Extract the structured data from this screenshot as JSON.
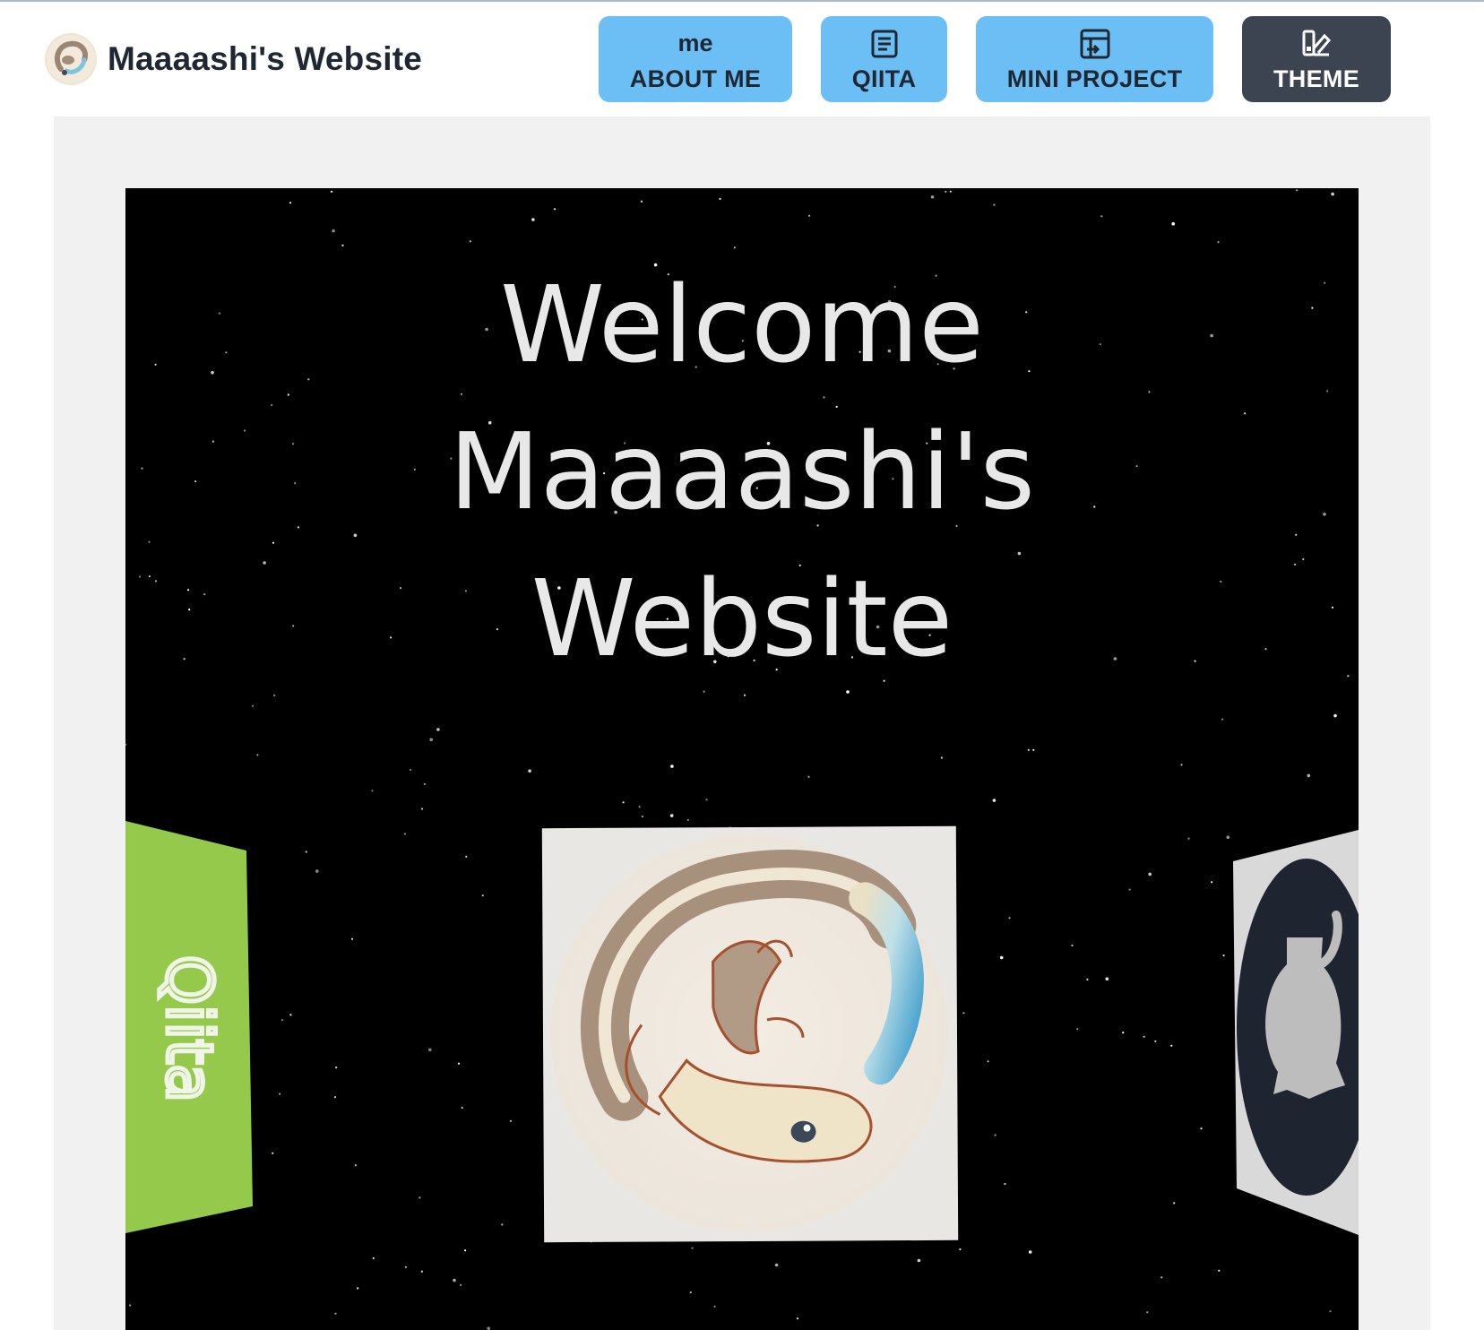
{
  "header": {
    "title": "Maaaashi's Website",
    "logo_icon": "salamander-logo-icon"
  },
  "nav": [
    {
      "id": "about",
      "top_text": "me",
      "label": "ABOUT ME",
      "icon": "me-text-icon"
    },
    {
      "id": "qiita",
      "top_text": "",
      "label": "QIITA",
      "icon": "article-icon"
    },
    {
      "id": "mini",
      "top_text": "",
      "label": "MINI PROJECT",
      "icon": "project-icon"
    },
    {
      "id": "theme",
      "top_text": "",
      "label": "THEME",
      "icon": "palette-icon"
    }
  ],
  "hero": {
    "line1": "Welcome",
    "line2": "Maaaashi's",
    "line3": "Website"
  },
  "carousel": {
    "left_panel_label": "Qiita",
    "center_icon": "salamander-illustration-icon",
    "right_icon": "github-icon"
  },
  "colors": {
    "nav_button": "#6cbff4",
    "theme_button": "#3c4452",
    "qiita_green": "#95c94b",
    "scene_bg": "#000000",
    "card_bg": "#f1f1f1"
  }
}
